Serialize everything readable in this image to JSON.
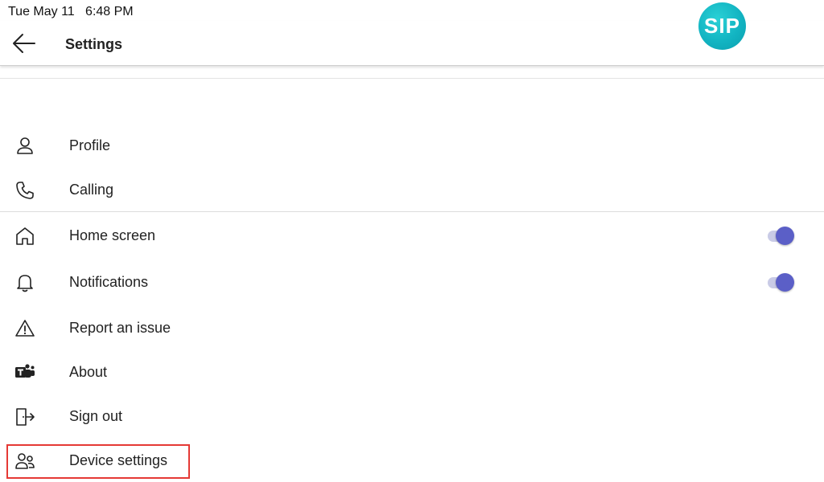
{
  "status_bar": {
    "date": "Tue May 11",
    "time": "6:48 PM"
  },
  "header": {
    "title": "Settings",
    "logo_text": "SIP"
  },
  "menu": {
    "items": [
      {
        "label": "Profile",
        "icon": "person-icon"
      },
      {
        "label": "Calling",
        "icon": "phone-icon"
      },
      {
        "label": "Home screen",
        "icon": "home-icon",
        "toggle": true
      },
      {
        "label": "Notifications",
        "icon": "bell-icon",
        "toggle": true
      },
      {
        "label": "Report an issue",
        "icon": "warning-icon"
      },
      {
        "label": "About",
        "icon": "teams-logo-icon"
      },
      {
        "label": "Sign out",
        "icon": "sign-out-icon"
      },
      {
        "label": "Device settings",
        "icon": "people-settings-icon",
        "highlighted": true
      }
    ]
  },
  "colors": {
    "accent": "#5b5fc7",
    "toggle_track": "#c9cbe6",
    "logo": "#12b4c2",
    "highlight_border": "#e53935"
  }
}
